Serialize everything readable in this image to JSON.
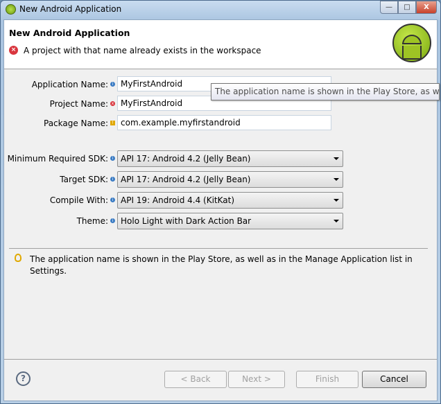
{
  "window": {
    "title": "New Android Application",
    "min": "—",
    "max": "□",
    "close": "X"
  },
  "header": {
    "title": "New Android Application",
    "error": "A project with that name already exists in the workspace"
  },
  "form": {
    "app_name": {
      "label": "Application Name:",
      "value": "MyFirstAndroid"
    },
    "project_name": {
      "label": "Project Name:",
      "value": "MyFirstAndroid"
    },
    "package_name": {
      "label": "Package Name:",
      "value": "com.example.myfirstandroid"
    },
    "min_sdk": {
      "label": "Minimum Required SDK:",
      "value": "API 17: Android 4.2 (Jelly Bean)"
    },
    "target_sdk": {
      "label": "Target SDK:",
      "value": "API 17: Android 4.2 (Jelly Bean)"
    },
    "compile_with": {
      "label": "Compile With:",
      "value": "API 19: Android 4.4 (KitKat)"
    },
    "theme": {
      "label": "Theme:",
      "value": "Holo Light with Dark Action Bar"
    }
  },
  "tooltip": "The application name is shown in the Play Store, as well",
  "hint": "The application name is shown in the Play Store, as well as in the Manage Application list in Settings.",
  "buttons": {
    "help": "?",
    "back": "< Back",
    "next": "Next >",
    "finish": "Finish",
    "cancel": "Cancel"
  }
}
